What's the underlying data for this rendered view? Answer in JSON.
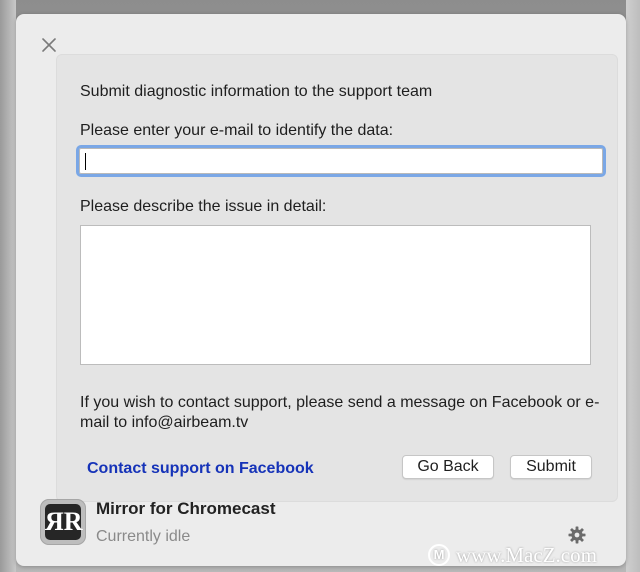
{
  "dialog": {
    "title": "Submit diagnostic information to the support team",
    "email_label": "Please enter your e-mail to identify the data:",
    "email_value": "",
    "issue_label": "Please describe the issue in detail:",
    "issue_value": "",
    "support_note": "If you wish to contact support, please send a message on Facebook or e-mail to info@airbeam.tv",
    "facebook_link": "Contact support on Facebook",
    "go_back_label": "Go Back",
    "submit_label": "Submit"
  },
  "footer": {
    "app_icon_letters": "ЯR",
    "app_name": "Mirror for Chromecast",
    "status": "Currently idle"
  },
  "icons": {
    "close": "close-icon",
    "gear": "gear-icon",
    "app": "app-logo-icon"
  },
  "watermark": {
    "logo_letter": "M",
    "text": "www.MacZ.com"
  },
  "colors": {
    "link": "#1633b8",
    "focus_ring": "#7aa7e6",
    "popover_bg": "#ececec",
    "panel_bg": "#e4e4e4"
  }
}
